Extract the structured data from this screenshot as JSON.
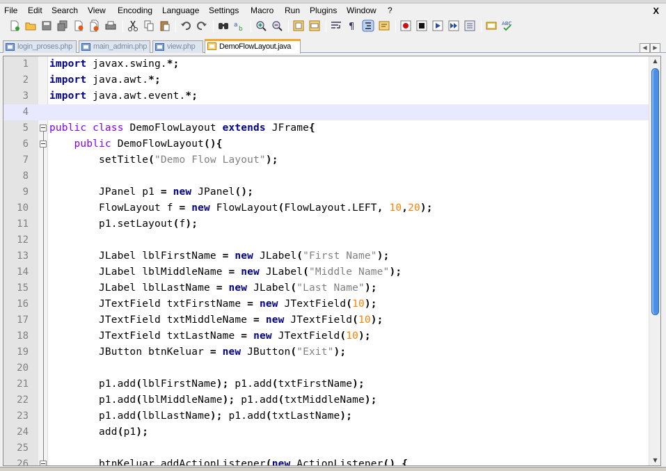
{
  "menu": {
    "items": [
      "File",
      "Edit",
      "Search",
      "View",
      "Encoding",
      "Language",
      "Settings",
      "Macro",
      "Run",
      "Plugins",
      "Window",
      "?"
    ],
    "close_label": "X"
  },
  "toolbar": {
    "buttons": [
      "new-file",
      "open-file",
      "save",
      "save-all",
      "close",
      "close-all",
      "print",
      "cut",
      "copy",
      "paste",
      "undo",
      "redo",
      "find",
      "replace",
      "zoom-in",
      "zoom-out",
      "sync-vertical",
      "sync-horizontal",
      "word-wrap",
      "show-all-characters",
      "indent-guide",
      "user-defined-language",
      "record-macro",
      "stop-recording",
      "play-macro",
      "run-macro-multiple",
      "save-macro",
      "function-list",
      "spell-check"
    ]
  },
  "tabs": [
    {
      "label": "login_proses.php",
      "active": false
    },
    {
      "label": "main_admin.php",
      "active": false
    },
    {
      "label": "view.php",
      "active": false
    },
    {
      "label": "DemoFlowLayout.java",
      "active": true
    }
  ],
  "editor": {
    "current_line": 4,
    "lines": [
      {
        "n": "1",
        "text": "import javax.swing.*;"
      },
      {
        "n": "2",
        "text": "import java.awt.*;"
      },
      {
        "n": "3",
        "text": "import java.awt.event.*;"
      },
      {
        "n": "4",
        "text": ""
      },
      {
        "n": "5",
        "text": "public class DemoFlowLayout extends JFrame{"
      },
      {
        "n": "6",
        "text": "    public DemoFlowLayout(){"
      },
      {
        "n": "7",
        "text": "        setTitle(\"Demo Flow Layout\");"
      },
      {
        "n": "8",
        "text": ""
      },
      {
        "n": "9",
        "text": "        JPanel p1 = new JPanel();"
      },
      {
        "n": "10",
        "text": "        FlowLayout f = new FlowLayout(FlowLayout.LEFT, 10,20);"
      },
      {
        "n": "11",
        "text": "        p1.setLayout(f);"
      },
      {
        "n": "12",
        "text": ""
      },
      {
        "n": "13",
        "text": "        JLabel lblFirstName = new JLabel(\"First Name\");"
      },
      {
        "n": "14",
        "text": "        JLabel lblMiddleName = new JLabel(\"Middle Name\");"
      },
      {
        "n": "15",
        "text": "        JLabel lblLastName = new JLabel(\"Last Name\");"
      },
      {
        "n": "16",
        "text": "        JTextField txtFirstName = new JTextField(10);"
      },
      {
        "n": "17",
        "text": "        JTextField txtMiddleName = new JTextField(10);"
      },
      {
        "n": "18",
        "text": "        JTextField txtLastName = new JTextField(10);"
      },
      {
        "n": "19",
        "text": "        JButton btnKeluar = new JButton(\"Exit\");"
      },
      {
        "n": "20",
        "text": ""
      },
      {
        "n": "21",
        "text": "        p1.add(lblFirstName); p1.add(txtFirstName);"
      },
      {
        "n": "22",
        "text": "        p1.add(lblMiddleName); p1.add(txtMiddleName);"
      },
      {
        "n": "23",
        "text": "        p1.add(lblLastName); p1.add(txtLastName);"
      },
      {
        "n": "24",
        "text": "        add(p1);"
      },
      {
        "n": "25",
        "text": ""
      },
      {
        "n": "26",
        "text": "        btnKeluar.addActionListener(new ActionListener() {"
      }
    ]
  },
  "colors": {
    "keyword": "#00008b",
    "modifier": "#8000ff",
    "string": "#808080",
    "number": "#ff8000",
    "current_line": "#e8e8ff",
    "active_tab_accent": "#f5a623"
  }
}
